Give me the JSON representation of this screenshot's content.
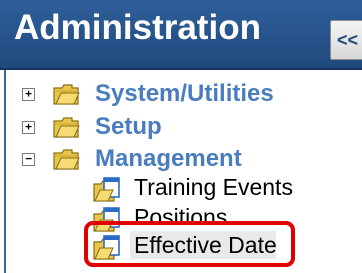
{
  "header": {
    "title": "Administration",
    "collapse_label": "<<"
  },
  "tree": {
    "nodes": [
      {
        "label": "System/Utilities",
        "expander": "+"
      },
      {
        "label": "Setup",
        "expander": "+"
      },
      {
        "label": "Management",
        "expander": "−"
      }
    ],
    "children": [
      {
        "label": "Training Events"
      },
      {
        "label": "Positions"
      },
      {
        "label": "Effective Date",
        "selected": true
      }
    ]
  },
  "colors": {
    "header_bg": "#1f497d",
    "node_text": "#4a7dc0",
    "highlight": "#e00000"
  }
}
